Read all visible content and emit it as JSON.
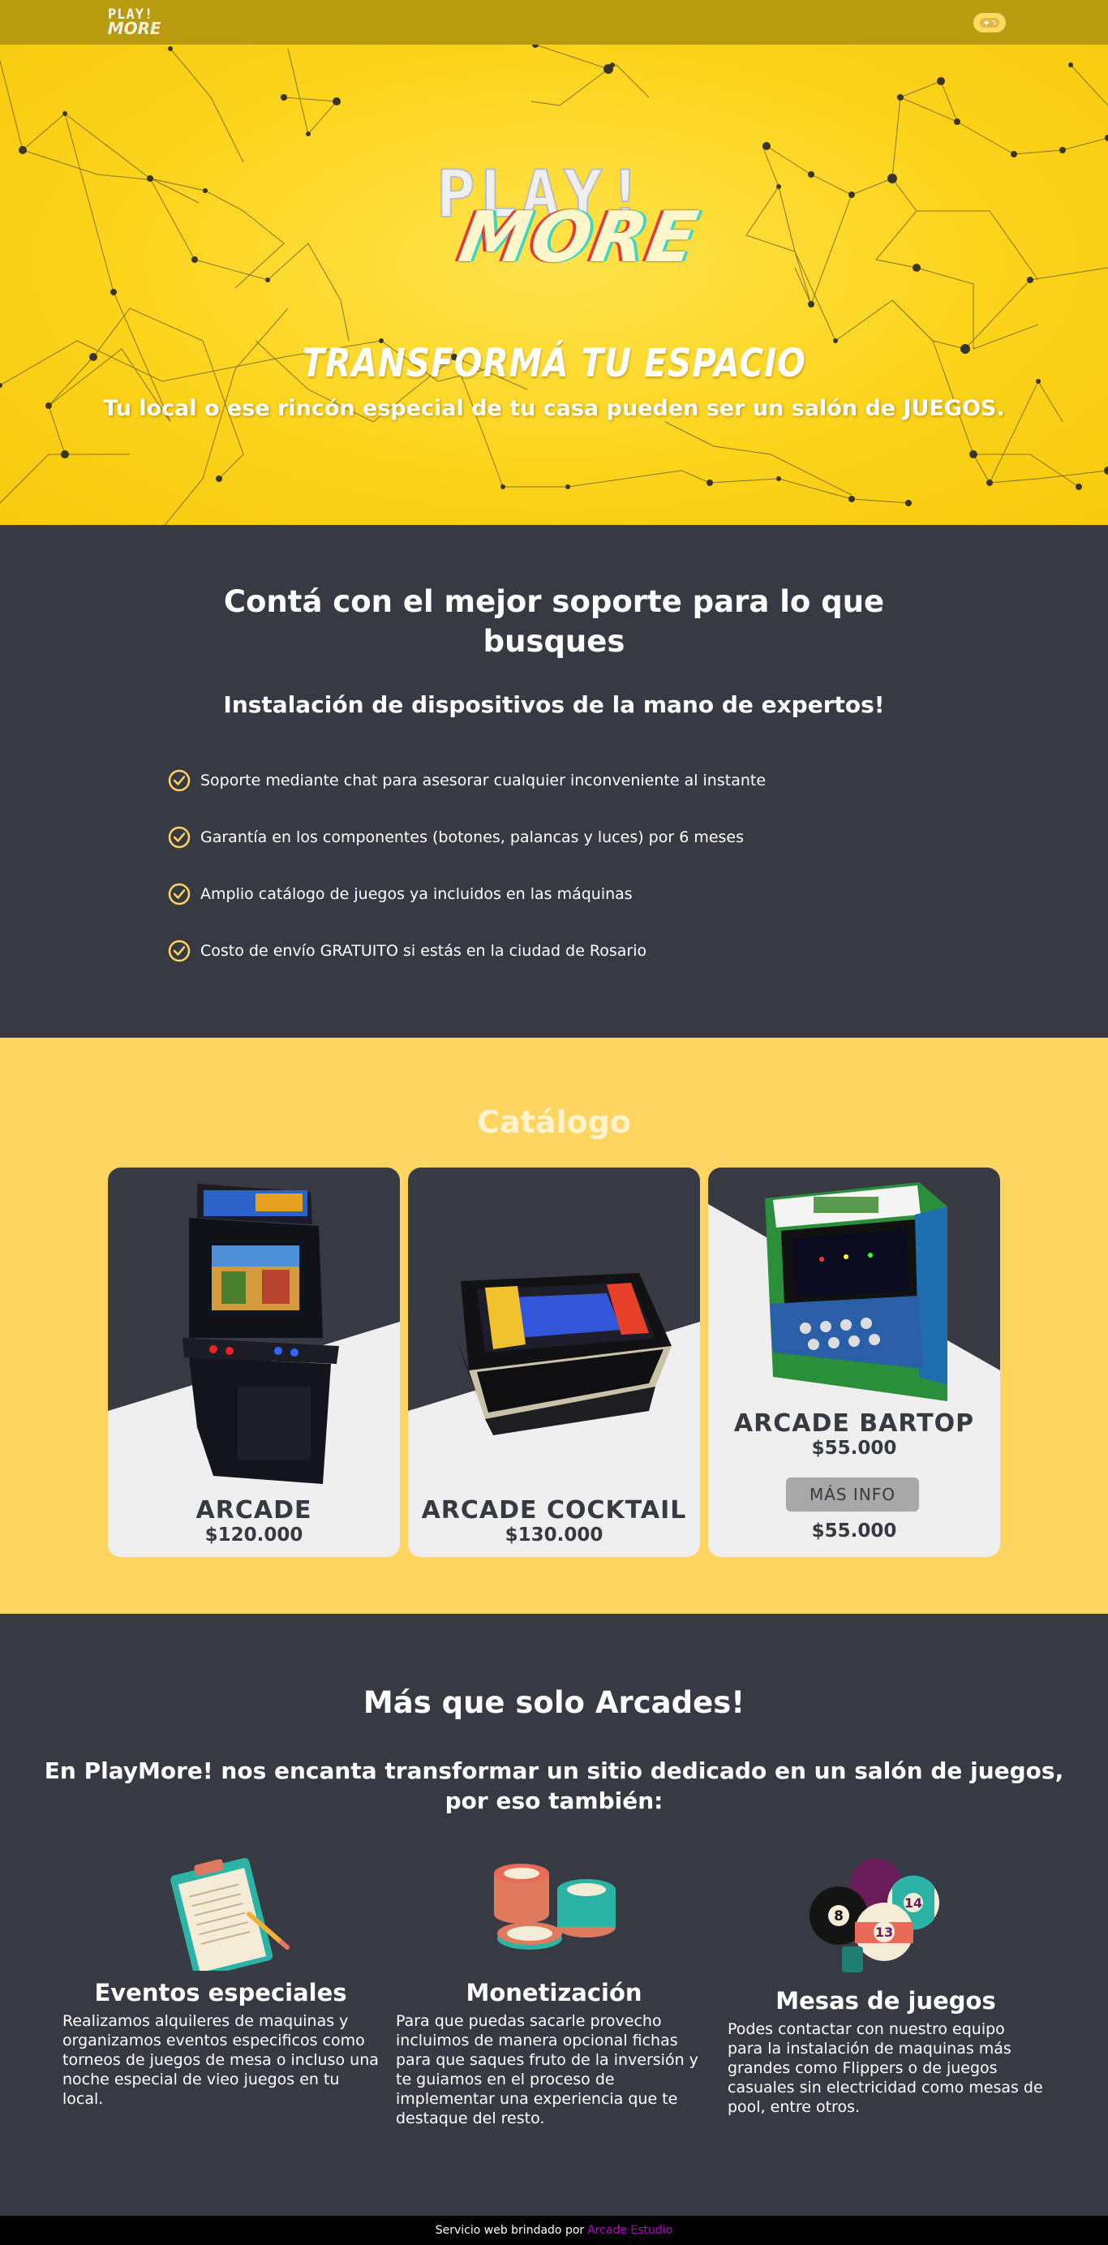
{
  "nav": {
    "logo_line1": "PLAY!",
    "logo_line2": "MORE",
    "toggle_icon": "gamepad-icon"
  },
  "hero": {
    "logo_play": "PLAY!",
    "logo_more": "MORE",
    "title": "TRANSFORMÁ TU ESPACIO",
    "subtitle": "Tu local o ese rincón especial de tu casa pueden ser un salón de JUEGOS."
  },
  "support": {
    "heading_line1": "Contá con el mejor soporte para lo que",
    "heading_line2": "busques",
    "subheading": "Instalación de dispositivos de la mano de expertos!",
    "items": [
      "Soporte mediante chat para asesorar cualquier inconveniente al instante",
      "Garantía en los componentes (botones, palancas y luces) por 6 meses",
      "Amplio catálogo de juegos ya incluidos en las máquinas",
      "Costo de envío GRATUITO si estás en la ciudad de Rosario"
    ]
  },
  "catalog": {
    "heading": "Catálogo",
    "cards": [
      {
        "name": "ARCADE",
        "price": "$120.000"
      },
      {
        "name": "ARCADE COCKTAIL",
        "price": "$130.000"
      },
      {
        "name": "ARCADE BARTOP",
        "price": "$55.000",
        "button": "MÁS INFO",
        "price_bottom": "$55.000"
      }
    ]
  },
  "more": {
    "heading": "Más que solo Arcades!",
    "subheading": "En PlayMore! nos encanta transformar un sitio dedicado en un salón de juegos, por eso también:",
    "features": [
      {
        "icon": "clipboard-icon",
        "title": "Eventos especiales",
        "text": "Realizamos alquileres de maquinas y organizamos eventos especificos como torneos de juegos de mesa o incluso una noche especial de vieo juegos en tu local."
      },
      {
        "icon": "poker-chips-icon",
        "title": "Monetización",
        "text": "Para que puedas sacarle provecho incluimos de manera opcional fichas para que saques fruto de la inversión y te guiamos en el proceso de implementar una experiencia que te destaque del resto."
      },
      {
        "icon": "billiard-balls-icon",
        "title": "Mesas de juegos",
        "text": "Podes contactar con nuestro equipo para la instalación de maquinas más grandes como Flippers o de juegos casuales sin electricidad como mesas de pool, entre otros.",
        "ball_numbers": [
          "8",
          "14",
          "13"
        ]
      }
    ]
  },
  "footer": {
    "text": "Servicio web brindado por",
    "link": "Arcade Estudio",
    "link_color": "#b400c8"
  },
  "colors": {
    "nav": "#b99b10",
    "hero": "#fcd41c",
    "dark": "#383a43",
    "catalog": "#ffd561",
    "accent": "#ffd966"
  }
}
